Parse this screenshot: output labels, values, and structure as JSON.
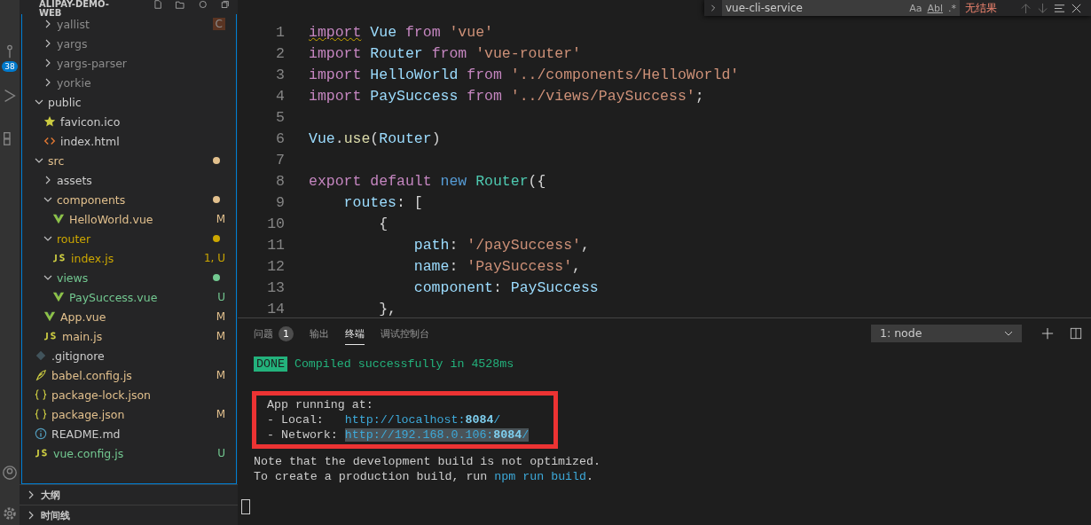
{
  "activity_bar": {
    "badge": "38"
  },
  "explorer": {
    "title": "ALIPAY-DEMO-WEB",
    "tree": [
      {
        "children": [
          {
            "name": "yallist",
            "kind": "folder",
            "expanded": false,
            "color": "#8c8c8c",
            "badge": "C"
          },
          {
            "name": "yargs",
            "kind": "folder",
            "expanded": false,
            "color": "#8c8c8c"
          },
          {
            "name": "yargs-parser",
            "kind": "folder",
            "expanded": false,
            "color": "#8c8c8c"
          },
          {
            "name": "yorkie",
            "kind": "folder",
            "expanded": false,
            "color": "#8c8c8c"
          }
        ]
      },
      {
        "name": "public",
        "kind": "folder",
        "expanded": true,
        "color": "#cccccc",
        "children": [
          {
            "name": "favicon.ico",
            "kind": "star",
            "color": "#cccccc"
          },
          {
            "name": "index.html",
            "kind": "html",
            "color": "#cccccc"
          }
        ]
      },
      {
        "name": "src",
        "kind": "folder",
        "expanded": true,
        "color": "#e2c08d",
        "dot": true,
        "children": [
          {
            "name": "assets",
            "kind": "folder",
            "expanded": false,
            "color": "#cccccc"
          },
          {
            "name": "components",
            "kind": "folder",
            "expanded": true,
            "color": "#e2c08d",
            "dot": true,
            "children": [
              {
                "name": "HelloWorld.vue",
                "kind": "vue",
                "color": "#e2c08d",
                "badge": "M"
              }
            ]
          },
          {
            "name": "router",
            "kind": "folder",
            "expanded": true,
            "color": "#cca700",
            "dot": true,
            "children": [
              {
                "name": "index.js",
                "kind": "js",
                "color": "#cca700",
                "badge": "1, U"
              }
            ]
          },
          {
            "name": "views",
            "kind": "folder",
            "expanded": true,
            "color": "#73c991",
            "dot": true,
            "children": [
              {
                "name": "PaySuccess.vue",
                "kind": "vue",
                "color": "#73c991",
                "badge": "U"
              }
            ]
          },
          {
            "name": "App.vue",
            "kind": "vue",
            "color": "#e2c08d",
            "badge": "M"
          },
          {
            "name": "main.js",
            "kind": "js",
            "color": "#e2c08d",
            "badge": "M"
          }
        ]
      },
      {
        "name": ".gitignore",
        "kind": "git",
        "color": "#cccccc"
      },
      {
        "name": "babel.config.js",
        "kind": "babel",
        "color": "#e2c08d",
        "badge": "M"
      },
      {
        "name": "package-lock.json",
        "kind": "json",
        "color": "#e2c08d"
      },
      {
        "name": "package.json",
        "kind": "json",
        "color": "#e2c08d",
        "badge": "M"
      },
      {
        "name": "README.md",
        "kind": "info",
        "color": "#cccccc"
      },
      {
        "name": "vue.config.js",
        "kind": "js",
        "color": "#73c991",
        "badge": "U"
      }
    ]
  },
  "sections": [
    {
      "label": "大纲",
      "expanded": false
    },
    {
      "label": "时间线",
      "expanded": false
    }
  ],
  "find_widget": {
    "value": "vue-cli-service",
    "options": [
      "Aa",
      "Abl",
      ".*"
    ],
    "result": "无结果"
  },
  "editor": {
    "lines": [
      {
        "number": "1",
        "tokens": [
          {
            "text": "import",
            "kind": "kw",
            "warning": true
          },
          {
            "text": " Vue",
            "kind": "var"
          },
          {
            "text": " from",
            "kind": "kw"
          },
          {
            "text": " 'vue'",
            "kind": "str"
          }
        ]
      },
      {
        "number": "2",
        "tokens": [
          {
            "text": "import",
            "kind": "kw"
          },
          {
            "text": " Router",
            "kind": "var"
          },
          {
            "text": " from",
            "kind": "kw"
          },
          {
            "text": " 'vue-router'",
            "kind": "str"
          }
        ]
      },
      {
        "number": "3",
        "tokens": [
          {
            "text": "import",
            "kind": "kw"
          },
          {
            "text": " HelloWorld",
            "kind": "var"
          },
          {
            "text": " from",
            "kind": "kw"
          },
          {
            "text": " '../components/HelloWorld'",
            "kind": "str"
          }
        ]
      },
      {
        "number": "4",
        "tokens": [
          {
            "text": "import",
            "kind": "kw"
          },
          {
            "text": " PaySuccess",
            "kind": "var"
          },
          {
            "text": " from",
            "kind": "kw"
          },
          {
            "text": " '../views/PaySuccess'",
            "kind": "str"
          },
          {
            "text": ";"
          }
        ]
      },
      {
        "number": "5"
      },
      {
        "number": "6",
        "tokens": [
          {
            "text": "Vue",
            "kind": "var"
          },
          {
            "text": "."
          },
          {
            "text": "use",
            "kind": "fn"
          },
          {
            "text": "("
          },
          {
            "text": "Router",
            "kind": "var"
          },
          {
            "text": ")"
          }
        ]
      },
      {
        "number": "7"
      },
      {
        "number": "8",
        "tokens": [
          {
            "text": "export",
            "kind": "kw"
          },
          {
            "text": " default",
            "kind": "kw"
          },
          {
            "text": " new",
            "kind": "storage"
          },
          {
            "text": " Router",
            "kind": "cls"
          },
          {
            "text": "({"
          }
        ]
      },
      {
        "number": "9",
        "tokens": [
          {
            "text": "    routes",
            "kind": "var"
          },
          {
            "text": ": ["
          }
        ]
      },
      {
        "number": "10",
        "tokens": [
          {
            "text": "        {"
          }
        ]
      },
      {
        "number": "11",
        "tokens": [
          {
            "text": "            path",
            "kind": "var"
          },
          {
            "text": ": "
          },
          {
            "text": "'/paySuccess'",
            "kind": "str"
          },
          {
            "text": ","
          }
        ]
      },
      {
        "number": "12",
        "tokens": [
          {
            "text": "            name",
            "kind": "var"
          },
          {
            "text": ": "
          },
          {
            "text": "'PaySuccess'",
            "kind": "str"
          },
          {
            "text": ","
          }
        ]
      },
      {
        "number": "13",
        "tokens": [
          {
            "text": "            component",
            "kind": "var"
          },
          {
            "text": ": "
          },
          {
            "text": "PaySuccess",
            "kind": "var"
          }
        ]
      },
      {
        "number": "14",
        "tokens": [
          {
            "text": "        },"
          }
        ]
      }
    ]
  },
  "panel": {
    "tabs": [
      {
        "label": "问题",
        "count": "1",
        "selected": false
      },
      {
        "label": "输出",
        "selected": false
      },
      {
        "label": "终端",
        "selected": true
      },
      {
        "label": "调试控制台",
        "selected": false
      }
    ],
    "terminal_select": "1: node",
    "terminal": {
      "done_badge": "DONE",
      "done_message": "Compiled successfully in 4528ms",
      "boxed_lines": [
        {
          "label": "App running at:"
        },
        {
          "label": "- Local:   ",
          "link": "http://localhost:**8084**/",
          "selected": false
        },
        {
          "label": "- Network: ",
          "link": "http://192.168.0.106:**8084**/",
          "selected": true
        }
      ],
      "note": "Note that the development build is not optimized.",
      "build_prefix": "To create a production build, run ",
      "build_command": "npm run build",
      "build_suffix": "."
    }
  }
}
